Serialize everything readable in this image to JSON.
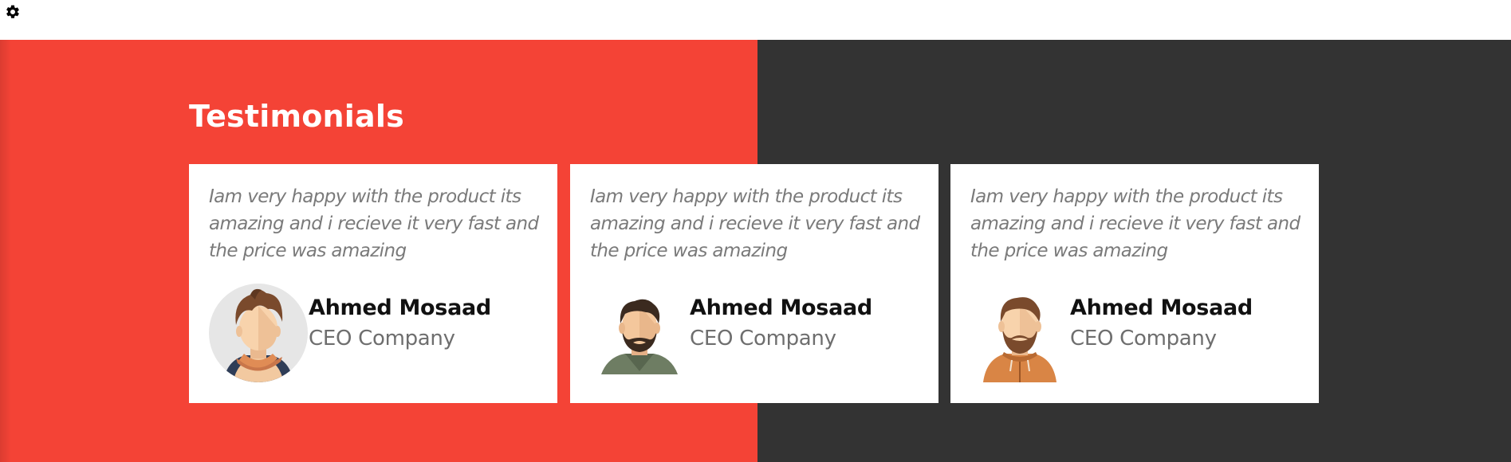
{
  "colors": {
    "accent": "#f44336",
    "dark": "#333333",
    "card_bg": "#ffffff"
  },
  "toolbar": {
    "settings_icon": "gear-icon"
  },
  "testimonials": {
    "title": "Testimonials",
    "items": [
      {
        "quote": "Iam very happy with the product its amazing and i recieve it very fast and the price was amazing",
        "name": "Ahmed Mosaad",
        "role": "CEO Company",
        "avatar_icon": "avatar-man-orange-scarf-icon"
      },
      {
        "quote": "Iam very happy with the product its amazing and i recieve it very fast and the price was amazing",
        "name": "Ahmed Mosaad",
        "role": "CEO Company",
        "avatar_icon": "avatar-man-bearded-green-shirt-icon"
      },
      {
        "quote": "Iam very happy with the product its amazing and i recieve it very fast and the price was amazing",
        "name": "Ahmed Mosaad",
        "role": "CEO Company",
        "avatar_icon": "avatar-man-bearded-orange-hoodie-icon"
      }
    ]
  }
}
